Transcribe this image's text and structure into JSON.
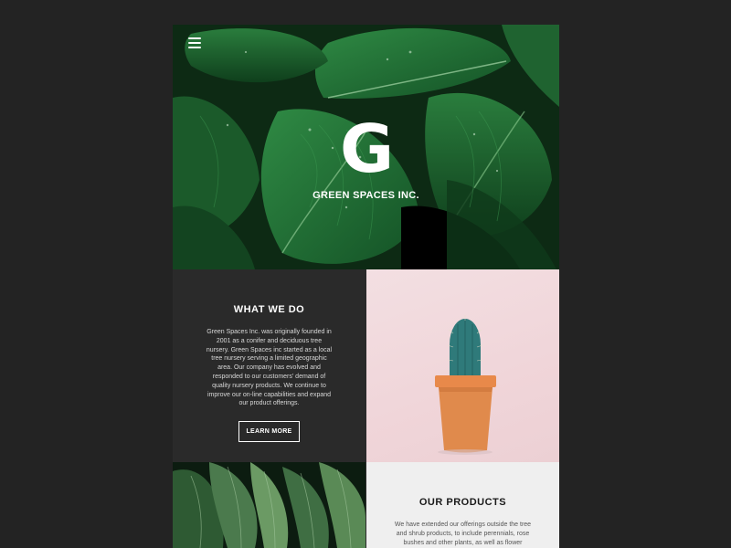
{
  "header": {
    "menu_icon": "hamburger-menu-icon",
    "brand_mark": "G",
    "brand_name": "GREEN SPACES INC."
  },
  "what_we_do": {
    "title": "WHAT WE DO",
    "body": "Green Spaces Inc. was originally founded in 2001 as a conifer and deciduous tree nursery. Green Spaces inc started as a local tree nursery serving a limited geographic area. Our company has evolved and responded to our customers' demand of quality nursery products. We continue to improve our on-line capabilities and expand our product offerings.",
    "button_label": "LEARN MORE"
  },
  "our_products": {
    "title": "OUR PRODUCTS",
    "body": "We have extended our offerings outside the tree and shrub products, to include perennials, rose bushes and other plants, as well as flower"
  },
  "colors": {
    "background": "#232323",
    "dark_panel": "#2a2a2a",
    "light_panel": "#efefef",
    "leaf_green": "#1f5a2c",
    "pot_orange": "#e08a4c",
    "pink_backdrop": "#f0d5d9"
  }
}
